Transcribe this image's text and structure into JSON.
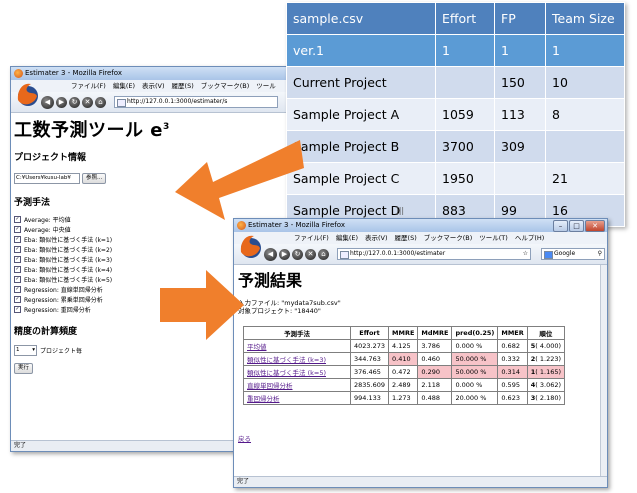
{
  "csv_table": {
    "headers": [
      "sample.csv",
      "Effort",
      "FP",
      "Team Size"
    ],
    "rows": [
      [
        "ver.1",
        "1",
        "1",
        "1"
      ],
      [
        "Current Project",
        "",
        "150",
        "10"
      ],
      [
        "Sample Project A",
        "1059",
        "113",
        "8"
      ],
      [
        "Sample Project B",
        "3700",
        "309",
        ""
      ],
      [
        "Sample Project C",
        "1950",
        "",
        "21"
      ],
      [
        "Sample Project D",
        "883",
        "99",
        "16"
      ]
    ]
  },
  "win1": {
    "title": "Estimater 3 - Mozilla Firefox",
    "menu": [
      "ファイル(F)",
      "編集(E)",
      "表示(V)",
      "履歴(S)",
      "ブックマーク(B)",
      "ツール"
    ],
    "url": "http://127.0.0.1:3000/estimater/s",
    "heading": "工数予測ツール e",
    "heading_sup": "3",
    "project_info_heading": "プロジェクト情報",
    "file_input_value": "C:¥Users¥kusu-lab¥",
    "browse_label": "参照...",
    "method_heading": "予測手法",
    "methods": [
      "Average: 平均値",
      "Average: 中央値",
      "Eba: 類似性に基づく手法 (k=1)",
      "Eba: 類似性に基づく手法 (k=2)",
      "Eba: 類似性に基づく手法 (k=3)",
      "Eba: 類似性に基づく手法 (k=4)",
      "Eba: 類似性に基づく手法 (k=5)",
      "Regression: 直線単回帰分析",
      "Regression: 累乗単回帰分析",
      "Regression: 重回帰分析"
    ],
    "freq_heading": "精度の計算頻度",
    "freq_select": "1",
    "freq_suffix": "プロジェクト毎",
    "run_label": "実行",
    "status": "完了"
  },
  "win2": {
    "title": "Estimater 3 - Mozilla Firefox",
    "menu": [
      "ファイル(F)",
      "編集(E)",
      "表示(V)",
      "履歴(S)",
      "ブックマーク(B)",
      "ツール(T)",
      "ヘルプ(H)"
    ],
    "url": "http://127.0.0.1:3000/estimater",
    "search_label": "Google",
    "heading": "予測結果",
    "input_file_line": "入力ファイル: \"mydata7sub.csv\"",
    "target_line": "対象プロジェクト: \"18440\"",
    "table_headers": [
      "予測手法",
      "Effort",
      "MMRE",
      "MdMRE",
      "pred(0.25)",
      "MMER",
      "順位"
    ],
    "rows": [
      {
        "method": "平均値",
        "effort": "4023.273",
        "mmre": "4.125",
        "mdmre": "3.786",
        "pred": "0.000 %",
        "mmer": "0.682",
        "rank": "5",
        "rank_val": "( 4.000)"
      },
      {
        "method": "類似性に基づく手法 (k=3)",
        "effort": "344.763",
        "mmre": "0.410",
        "mdmre": "0.460",
        "pred": "50.000 %",
        "mmer": "0.332",
        "rank": "2",
        "rank_val": "( 1.223)"
      },
      {
        "method": "類似性に基づく手法 (k=5)",
        "effort": "376.465",
        "mmre": "0.472",
        "mdmre": "0.290",
        "pred": "50.000 %",
        "mmer": "0.314",
        "rank": "1",
        "rank_val": "( 1.165)"
      },
      {
        "method": "直線単回帰分析",
        "effort": "2835.609",
        "mmre": "2.489",
        "mdmre": "2.118",
        "pred": "0.000 %",
        "mmer": "0.595",
        "rank": "4",
        "rank_val": "( 3.062)"
      },
      {
        "method": "重回帰分析",
        "effort": "994.133",
        "mmre": "1.273",
        "mdmre": "0.488",
        "pred": "20.000 %",
        "mmer": "0.623",
        "rank": "3",
        "rank_val": "( 2.180)"
      }
    ],
    "back_label": "戻る",
    "status": "完了"
  },
  "colors": {
    "csv_header": "#4f81bd",
    "arrow": "#f07f2c",
    "highlight": "#f7c3c8"
  }
}
